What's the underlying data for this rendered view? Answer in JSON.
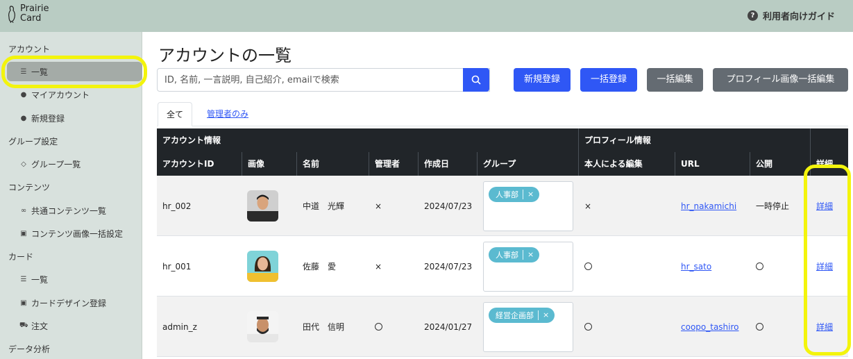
{
  "header": {
    "logo_line1": "Prairie",
    "logo_line2": "Card",
    "guide_label": "利用者向けガイド"
  },
  "sidebar": {
    "account_section": "アカウント",
    "account_list": "一覧",
    "my_account": "マイアカウント",
    "new_register": "新規登録",
    "group_section": "グループ設定",
    "group_list": "グループ一覧",
    "content_section": "コンテンツ",
    "common_content_list": "共通コンテンツ一覧",
    "content_image_bulk": "コンテンツ画像一括設定",
    "card_section": "カード",
    "card_list": "一覧",
    "card_design_register": "カードデザイン登録",
    "order": "注文",
    "analytics_section": "データ分析"
  },
  "main": {
    "title": "アカウントの一覧",
    "search_placeholder": "ID, 名前, 一言説明, 自己紹介, emailで検索",
    "buttons": {
      "new_register": "新規登録",
      "bulk_register": "一括登録",
      "bulk_edit": "一括編集",
      "profile_image_bulk_edit": "プロフィール画像一括編集"
    },
    "tabs": {
      "all": "全て",
      "admins_only": "管理者のみ"
    }
  },
  "table": {
    "group_headers": {
      "account_info": "アカウント情報",
      "profile_info": "プロフィール情報"
    },
    "columns": {
      "account_id": "アカウントID",
      "image": "画像",
      "name": "名前",
      "admin": "管理者",
      "created": "作成日",
      "group": "グループ",
      "self_edit": "本人による編集",
      "url": "URL",
      "public": "公開",
      "detail": "詳細"
    },
    "rows": [
      {
        "id": "hr_002",
        "name": "中道　光輝",
        "admin": "×",
        "created": "2024/07/23",
        "group": "人事部",
        "self_edit": "×",
        "url": "hr_nakamichi",
        "public": "一時停止",
        "detail": "詳細"
      },
      {
        "id": "hr_001",
        "name": "佐藤　愛",
        "admin": "×",
        "created": "2024/07/23",
        "group": "人事部",
        "self_edit": "",
        "url": "hr_sato",
        "public": "",
        "detail": "詳細"
      },
      {
        "id": "admin_z",
        "name": "田代　信明",
        "admin": "",
        "created": "2024/01/27",
        "group": "経営企画部",
        "self_edit": "",
        "url": "coopo_tashiro",
        "public": "",
        "detail": "詳細"
      }
    ]
  }
}
